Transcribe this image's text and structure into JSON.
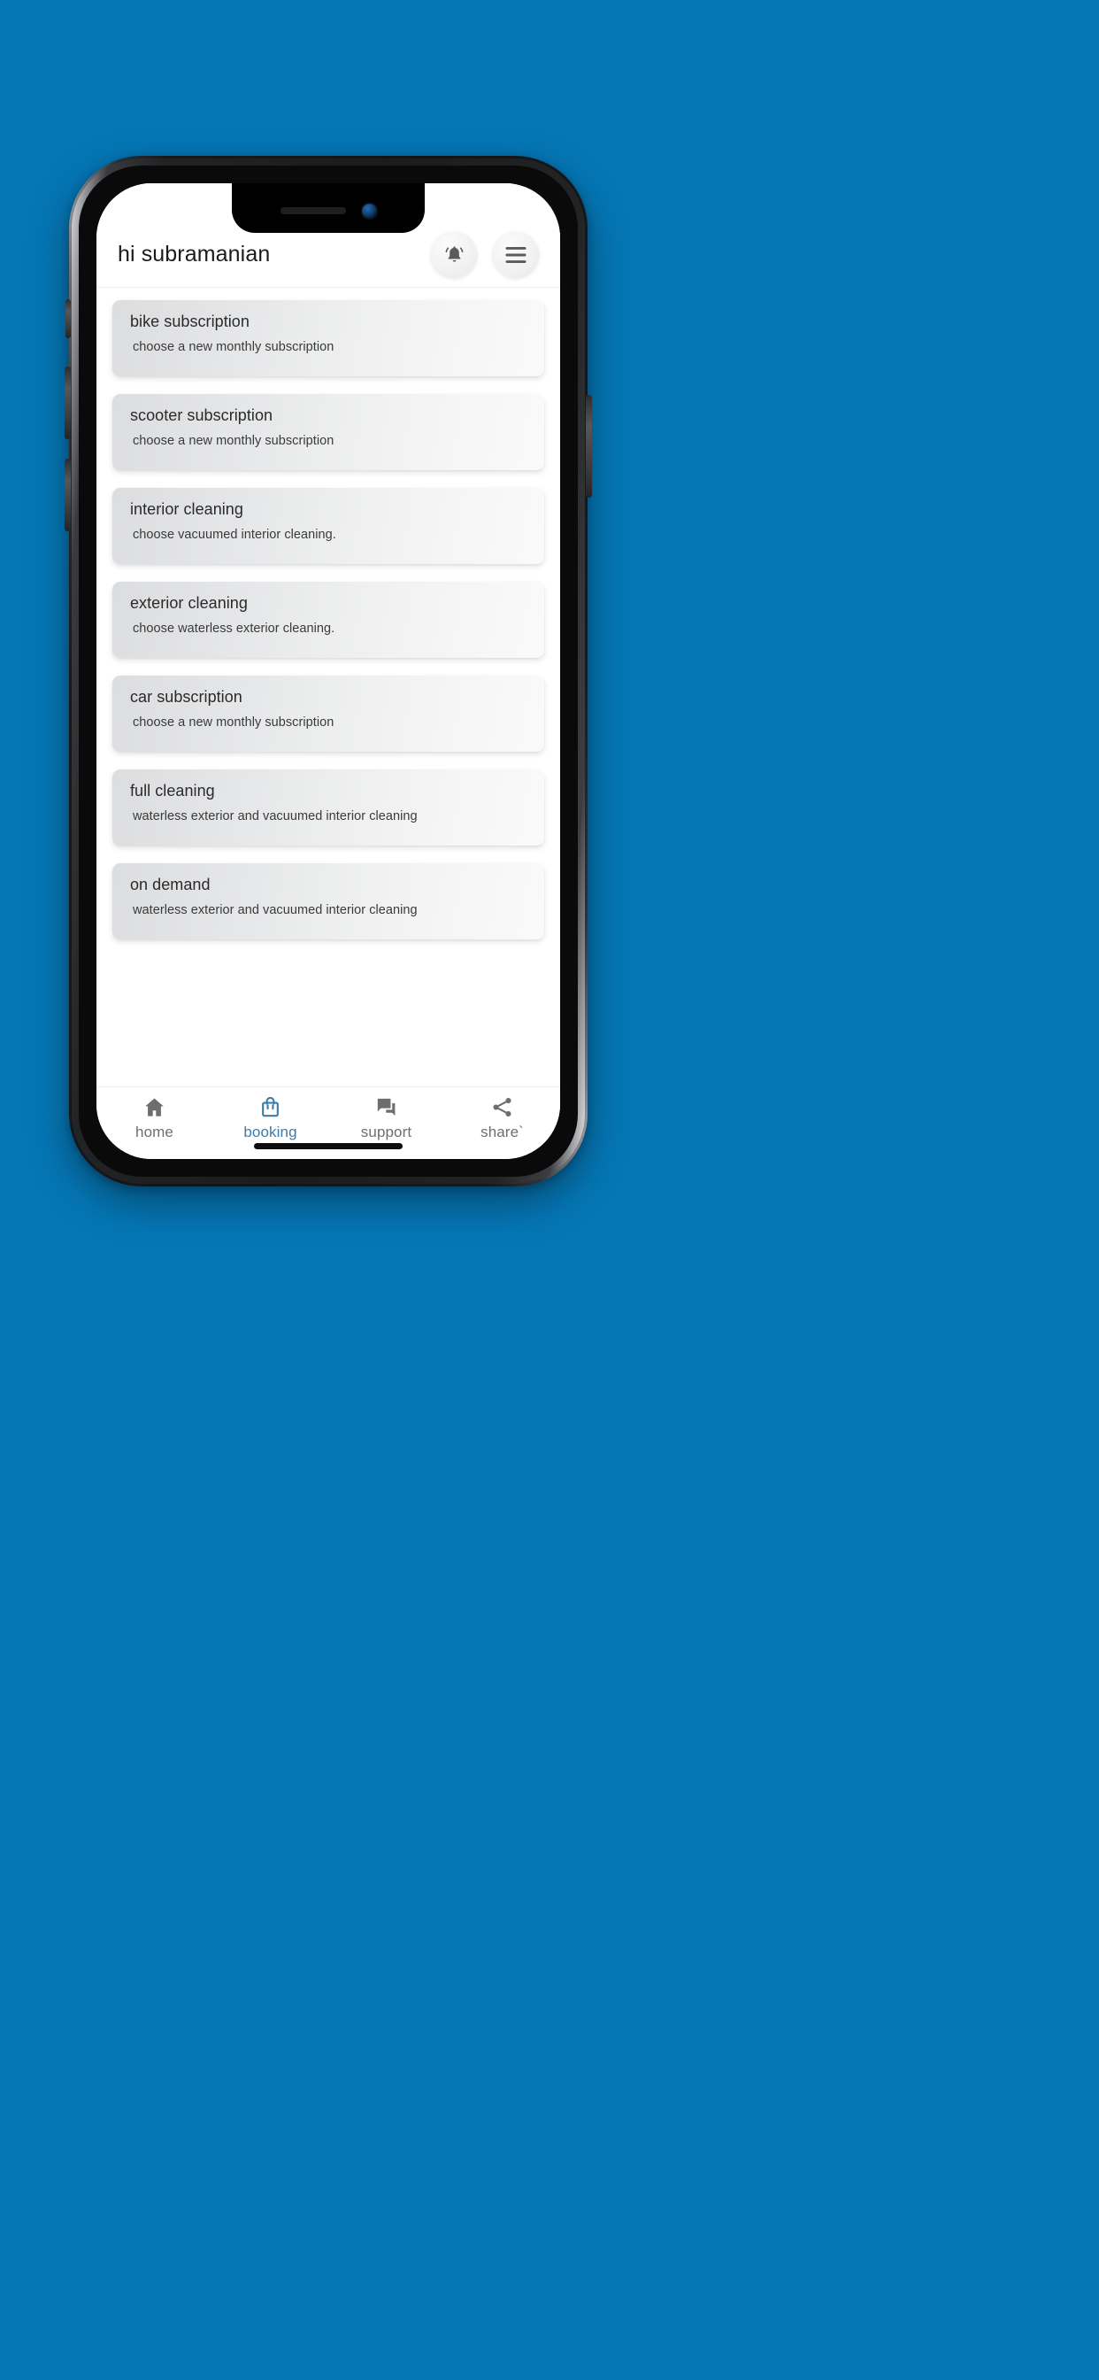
{
  "theme": {
    "page_background": "#0577b6",
    "accent": "#3d7cab",
    "inactive_nav": "#6e6e6e",
    "card_gradient_start": "#dcdddf",
    "card_gradient_end": "#fafafb",
    "screen_background": "#ffffff"
  },
  "header": {
    "greeting": "hi subramanian",
    "notification_icon": "bell-ringing-icon",
    "menu_icon": "hamburger-menu-icon"
  },
  "cards": [
    {
      "title": "bike subscription",
      "subtitle": "choose a new monthly subscription"
    },
    {
      "title": "scooter subscription",
      "subtitle": "choose a new monthly subscription"
    },
    {
      "title": "interior cleaning",
      "subtitle": "choose vacuumed interior cleaning."
    },
    {
      "title": "exterior cleaning",
      "subtitle": "choose waterless exterior cleaning."
    },
    {
      "title": "car subscription",
      "subtitle": "choose a new monthly subscription"
    },
    {
      "title": "full cleaning",
      "subtitle": "waterless exterior and vacuumed interior cleaning"
    },
    {
      "title": "on demand",
      "subtitle": "waterless exterior and vacuumed interior cleaning"
    }
  ],
  "bottom_nav": {
    "items": [
      {
        "label": "home",
        "icon": "home-icon",
        "active": false
      },
      {
        "label": "booking",
        "icon": "shopping-bag-icon",
        "active": true
      },
      {
        "label": "support",
        "icon": "chat-bubbles-icon",
        "active": false
      },
      {
        "label": "share`",
        "icon": "share-nodes-icon",
        "active": false
      }
    ]
  },
  "device": {
    "notch_speaker": "speaker-grille",
    "notch_camera": "front-camera-lens",
    "home_indicator": "home-indicator-bar"
  }
}
